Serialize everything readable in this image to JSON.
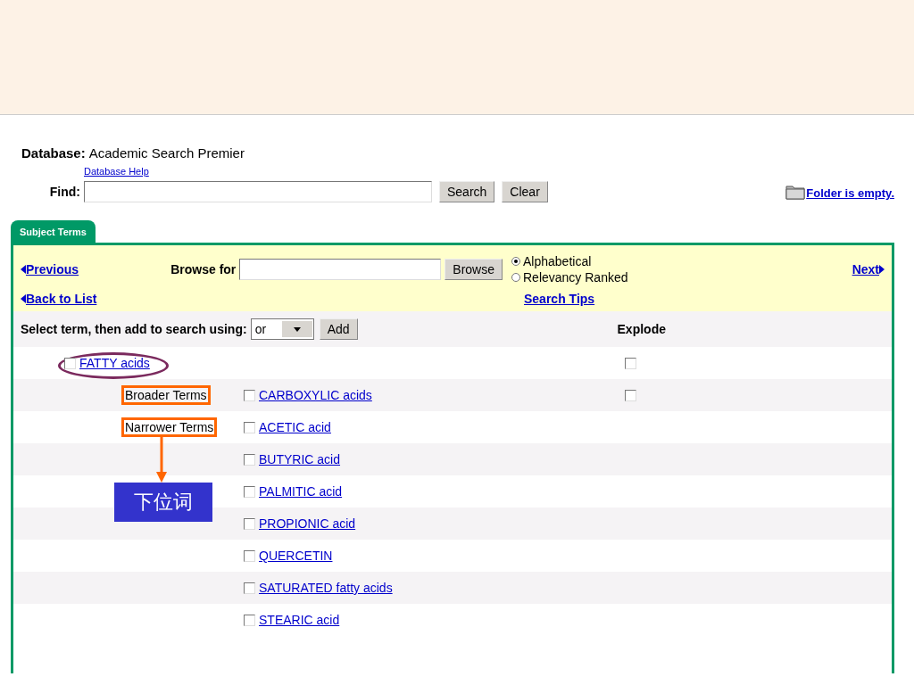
{
  "database": {
    "label": "Database:",
    "name": "Academic Search Premier",
    "help_link": "Database Help"
  },
  "find": {
    "label": "Find:",
    "buttons": [
      "Search",
      "Clear"
    ]
  },
  "folder": {
    "text": "Folder is empty."
  },
  "tabs": [
    {
      "label": "Subject Terms",
      "selected": true
    }
  ],
  "browse": {
    "previous": "Previous",
    "label": "Browse for",
    "button": "Browse",
    "next": "Next",
    "back": "Back to List",
    "tips": "Search Tips",
    "options": [
      {
        "label": "Alphabetical",
        "selected": true
      },
      {
        "label": "Relevancy Ranked",
        "selected": false
      }
    ]
  },
  "select_bar": {
    "label": "Select term, then add to search using:",
    "operator": "or",
    "button": "Add",
    "explode_header": "Explode"
  },
  "main_term": {
    "label": "FATTY acids",
    "checked": false,
    "explode_checked": false
  },
  "related": [
    {
      "group": "Broader Terms",
      "term": "CARBOXYLIC acids",
      "checked": false,
      "explode_checked": false
    },
    {
      "group": "Narrower Terms",
      "term": "ACETIC acid",
      "checked": false
    },
    {
      "term": "BUTYRIC acid",
      "checked": false
    },
    {
      "term": "PALMITIC acid",
      "checked": false
    },
    {
      "term": "PROPIONIC acid",
      "checked": false
    },
    {
      "term": "QUERCETIN",
      "checked": false
    },
    {
      "term": "SATURATED fatty acids",
      "checked": false
    },
    {
      "term": "STEARIC acid",
      "checked": false
    }
  ],
  "callout": {
    "text": "下位词"
  }
}
